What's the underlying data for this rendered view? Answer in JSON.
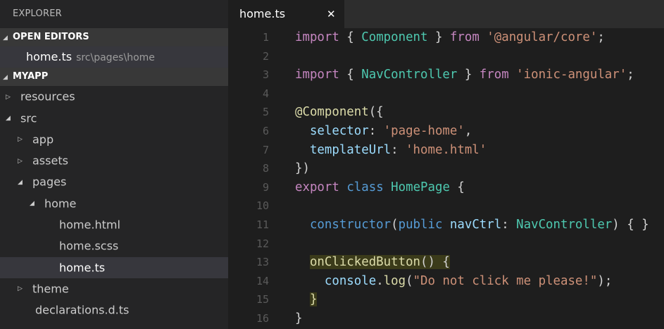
{
  "sidebar": {
    "title": "EXPLORER",
    "open_editors": {
      "label": "OPEN EDITORS",
      "items": [
        {
          "name": "home.ts",
          "path": "src\\pages\\home"
        }
      ]
    },
    "project": {
      "label": "MYAPP",
      "tree": [
        {
          "label": "resources",
          "twisty": "▷",
          "depth": 1
        },
        {
          "label": "src",
          "twisty": "◢",
          "depth": 1
        },
        {
          "label": "app",
          "twisty": "▷",
          "depth": 2
        },
        {
          "label": "assets",
          "twisty": "▷",
          "depth": 2
        },
        {
          "label": "pages",
          "twisty": "◢",
          "depth": 2
        },
        {
          "label": "home",
          "twisty": "◢",
          "depth": 3
        },
        {
          "label": "home.html",
          "twisty": "",
          "depth": 4
        },
        {
          "label": "home.scss",
          "twisty": "",
          "depth": 4
        },
        {
          "label": "home.ts",
          "twisty": "",
          "depth": 4,
          "selected": true
        },
        {
          "label": "theme",
          "twisty": "▷",
          "depth": 2
        },
        {
          "label": "declarations.d.ts",
          "twisty": "",
          "depth": 2
        }
      ]
    }
  },
  "tabs": [
    {
      "label": "home.ts",
      "close": "✕",
      "active": true
    }
  ],
  "editor": {
    "lines": [
      {
        "n": "1",
        "tokens": [
          [
            "kw",
            "import"
          ],
          [
            "pl",
            " { "
          ],
          [
            "typ",
            "Component"
          ],
          [
            "pl",
            " } "
          ],
          [
            "kw",
            "from"
          ],
          [
            "pl",
            " "
          ],
          [
            "str",
            "'@angular/core'"
          ],
          [
            "pl",
            ";"
          ]
        ]
      },
      {
        "n": "2",
        "tokens": []
      },
      {
        "n": "3",
        "tokens": [
          [
            "kw",
            "import"
          ],
          [
            "pl",
            " { "
          ],
          [
            "typ",
            "NavController"
          ],
          [
            "pl",
            " } "
          ],
          [
            "kw",
            "from"
          ],
          [
            "pl",
            " "
          ],
          [
            "str",
            "'ionic-angular'"
          ],
          [
            "pl",
            ";"
          ]
        ]
      },
      {
        "n": "4",
        "tokens": []
      },
      {
        "n": "5",
        "tokens": [
          [
            "fn",
            "@Component"
          ],
          [
            "pl",
            "({"
          ]
        ]
      },
      {
        "n": "6",
        "tokens": [
          [
            "pl",
            "  "
          ],
          [
            "var",
            "selector"
          ],
          [
            "pl",
            ": "
          ],
          [
            "str",
            "'page-home'"
          ],
          [
            "pl",
            ","
          ]
        ]
      },
      {
        "n": "7",
        "tokens": [
          [
            "pl",
            "  "
          ],
          [
            "var",
            "templateUrl"
          ],
          [
            "pl",
            ": "
          ],
          [
            "str",
            "'home.html'"
          ]
        ]
      },
      {
        "n": "8",
        "tokens": [
          [
            "pl",
            "})"
          ]
        ]
      },
      {
        "n": "9",
        "tokens": [
          [
            "kw",
            "export"
          ],
          [
            "pl",
            " "
          ],
          [
            "kwb",
            "class"
          ],
          [
            "pl",
            " "
          ],
          [
            "typ",
            "HomePage"
          ],
          [
            "pl",
            " {"
          ]
        ]
      },
      {
        "n": "10",
        "tokens": []
      },
      {
        "n": "11",
        "tokens": [
          [
            "pl",
            "  "
          ],
          [
            "kwb",
            "constructor"
          ],
          [
            "pl",
            "("
          ],
          [
            "kwb",
            "public"
          ],
          [
            "pl",
            " "
          ],
          [
            "var",
            "navCtrl"
          ],
          [
            "pl",
            ": "
          ],
          [
            "typ",
            "NavController"
          ],
          [
            "pl",
            ") { }"
          ]
        ]
      },
      {
        "n": "12",
        "tokens": []
      },
      {
        "n": "13",
        "tokens": [
          [
            "pl",
            "  "
          ],
          [
            "fn",
            "onClickedButton",
            "hl"
          ],
          [
            "pl",
            "() {",
            "hl"
          ]
        ]
      },
      {
        "n": "14",
        "tokens": [
          [
            "pl",
            "    "
          ],
          [
            "var",
            "console"
          ],
          [
            "pl",
            "."
          ],
          [
            "fn",
            "log"
          ],
          [
            "pl",
            "("
          ],
          [
            "str",
            "\"Do not click me please!\""
          ],
          [
            "pl",
            ");"
          ]
        ]
      },
      {
        "n": "15",
        "tokens": [
          [
            "pl",
            "  "
          ],
          [
            "fn",
            "}",
            "hl"
          ]
        ]
      },
      {
        "n": "16",
        "tokens": [
          [
            "pl",
            "}"
          ]
        ]
      }
    ]
  }
}
